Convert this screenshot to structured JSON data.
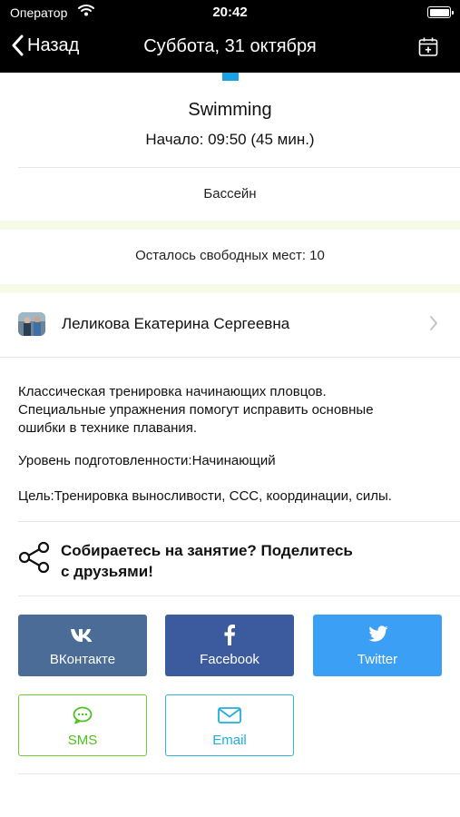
{
  "status_bar": {
    "carrier": "Оператор",
    "time": "20:42"
  },
  "nav": {
    "back_label": "Назад",
    "title": "Суббота, 31 октября"
  },
  "event": {
    "name": "Swimming",
    "start": "Начало: 09:50 (45 мин.)",
    "location": "Бассейн",
    "free_places": "Осталось свободных мест: 10"
  },
  "trainer": {
    "name": "Леликова Екатерина Сергеевна"
  },
  "description": {
    "line1": "Классическая тренировка начинающих пловцов.",
    "line2": "Специальные упражнения  помогут исправить основные",
    "line3": "ошибки в технике плавания.",
    "level": "Уровень подготовленности:Начинающий",
    "goal": "Цель:Тренировка выносливости, ССС, координации, силы."
  },
  "share": {
    "line1": "Собираетесь на занятие? Поделитесь",
    "line2": "с друзьями!",
    "buttons": {
      "vk": "ВКонтакте",
      "facebook": "Facebook",
      "twitter": "Twitter",
      "sms": "SMS",
      "email": "Email"
    }
  },
  "colors": {
    "accent": "#1ba1e2",
    "vk": "#4a6c96",
    "facebook": "#3b5b9e",
    "twitter": "#3b9ff5",
    "sms": "#4fc11e",
    "email": "#21aede",
    "band": "#f6fbe8"
  },
  "icons": {
    "back": "chevron-left-icon",
    "calendar": "calendar-add-icon",
    "trainer_chevron": "chevron-right-icon",
    "share": "share-icon",
    "vk": "vk-icon",
    "facebook": "facebook-icon",
    "twitter": "twitter-icon",
    "sms": "sms-bubble-icon",
    "email": "envelope-icon"
  }
}
